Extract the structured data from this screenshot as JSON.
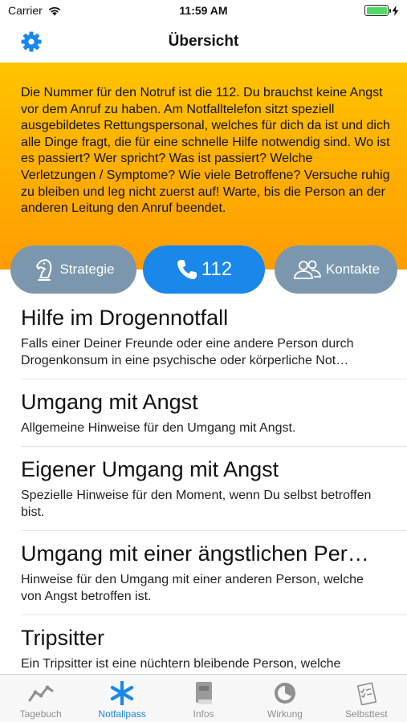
{
  "status_bar": {
    "carrier": "Carrier",
    "time": "11:59 AM",
    "battery_level": 1.0,
    "battery_color": "#4cd964"
  },
  "nav": {
    "title": "Übersicht",
    "settings_icon": "gear-icon"
  },
  "banner": {
    "text": "Die Nummer für den Notruf ist die 112. Du brauchst keine Angst vor dem Anruf zu haben. Am Notfalltelefon sitzt speziell ausgebildetes Rettungspersonal, welches für dich da ist und dich alle Dinge fragt, die für eine schnelle Hilfe notwendig sind. Wo ist es passiert? Wer spricht? Was ist passiert? Welche Verletzungen / Symptome? Wie viele Betroffene? Versuche ruhig zu bleiben und leg nicht zuerst auf! Warte, bis die Person an der anderen Leitung den Anruf beendet.",
    "color_top": "#ffc300",
    "color_bottom": "#ff9c00"
  },
  "actions": {
    "strategy_label": "Strategie",
    "call_label": "112",
    "contacts_label": "Kontakte"
  },
  "list": {
    "items": [
      {
        "title": "Hilfe im Drogennotfall",
        "subtitle": "Falls einer Deiner Freunde oder eine andere Person durch Drogenkonsum in eine psychische oder körperliche Not…"
      },
      {
        "title": "Umgang mit Angst",
        "subtitle": "Allgemeine Hinweise für den Umgang mit Angst."
      },
      {
        "title": "Eigener Umgang mit Angst",
        "subtitle": "Spezielle Hinweise für den Moment, wenn Du selbst betroffen bist."
      },
      {
        "title": "Umgang mit einer ängstlichen Per…",
        "subtitle": "Hinweise für den Umgang mit einer anderen Person, welche von Angst betroffen ist."
      },
      {
        "title": "Tripsitter",
        "subtitle": "Ein Tripsitter ist eine nüchtern bleibende Person, welche"
      }
    ]
  },
  "tabs": [
    {
      "label": "Tagebuch",
      "icon": "chart-line-icon",
      "active": false
    },
    {
      "label": "Notfallpass",
      "icon": "asterisk-icon",
      "active": true
    },
    {
      "label": "Infos",
      "icon": "book-icon",
      "active": false
    },
    {
      "label": "Wirkung",
      "icon": "dial-icon",
      "active": false
    },
    {
      "label": "Selbsttest",
      "icon": "checklist-icon",
      "active": false
    }
  ],
  "colors": {
    "accent": "#1a87ea",
    "secondary_button": "#7b97ad",
    "tab_inactive": "#8e8e8e"
  }
}
